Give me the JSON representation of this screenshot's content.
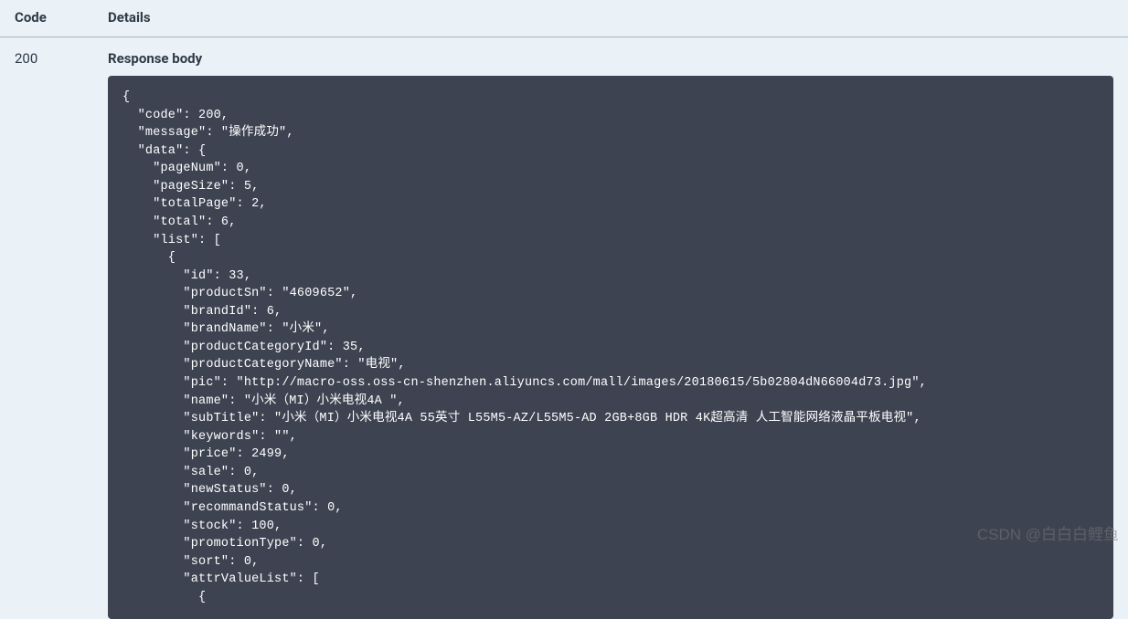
{
  "headers": {
    "code": "Code",
    "details": "Details"
  },
  "response": {
    "status_code": "200",
    "body_label": "Response body",
    "body_text": "{\n  \"code\": 200,\n  \"message\": \"操作成功\",\n  \"data\": {\n    \"pageNum\": 0,\n    \"pageSize\": 5,\n    \"totalPage\": 2,\n    \"total\": 6,\n    \"list\": [\n      {\n        \"id\": 33,\n        \"productSn\": \"4609652\",\n        \"brandId\": 6,\n        \"brandName\": \"小米\",\n        \"productCategoryId\": 35,\n        \"productCategoryName\": \"电视\",\n        \"pic\": \"http://macro-oss.oss-cn-shenzhen.aliyuncs.com/mall/images/20180615/5b02804dN66004d73.jpg\",\n        \"name\": \"小米（MI）小米电视4A \",\n        \"subTitle\": \"小米（MI）小米电视4A 55英寸 L55M5-AZ/L55M5-AD 2GB+8GB HDR 4K超高清 人工智能网络液晶平板电视\",\n        \"keywords\": \"\",\n        \"price\": 2499,\n        \"sale\": 0,\n        \"newStatus\": 0,\n        \"recommandStatus\": 0,\n        \"stock\": 100,\n        \"promotionType\": 0,\n        \"sort\": 0,\n        \"attrValueList\": [\n          {"
  },
  "watermark": "CSDN @白白白鲤鱼"
}
